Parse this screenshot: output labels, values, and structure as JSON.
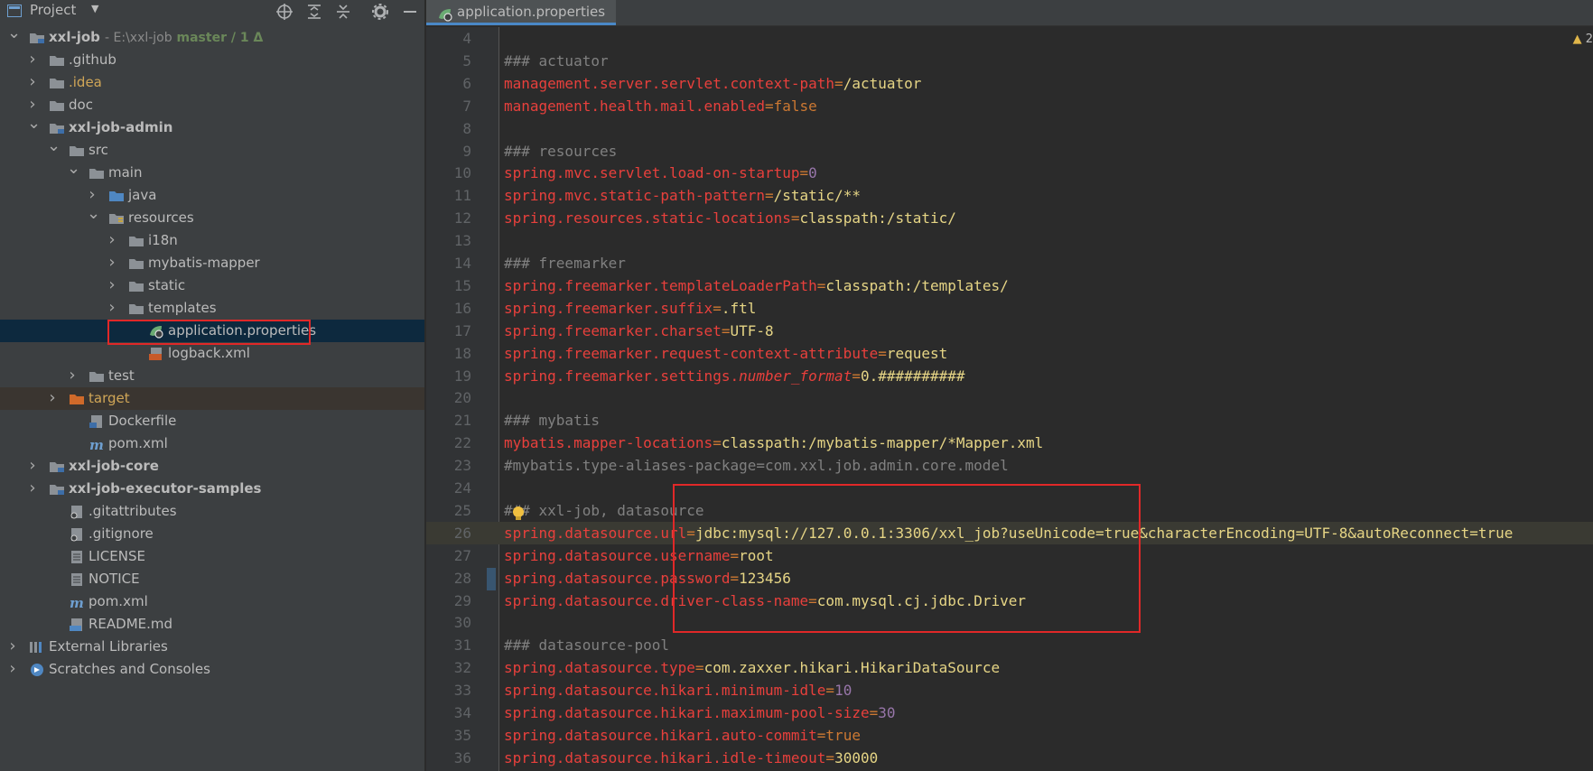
{
  "project_panel": {
    "title": "Project",
    "tree": [
      {
        "label": "xxl-job",
        "bold": true,
        "extra": " - E:\\xxl-job",
        "branch": " master / 1 Δ",
        "depth": 0,
        "arrow": "v",
        "icon": "module-folder-icon"
      },
      {
        "label": ".github",
        "depth": 1,
        "arrow": ">",
        "icon": "folder-icon"
      },
      {
        "label": ".idea",
        "depth": 1,
        "arrow": ">",
        "icon": "folder-icon",
        "style": "excluded-text"
      },
      {
        "label": "doc",
        "depth": 1,
        "arrow": ">",
        "icon": "folder-icon"
      },
      {
        "label": "xxl-job-admin",
        "bold": true,
        "depth": 1,
        "arrow": "v",
        "icon": "module-folder-icon"
      },
      {
        "label": "src",
        "depth": 2,
        "arrow": "v",
        "icon": "folder-icon"
      },
      {
        "label": "main",
        "depth": 3,
        "arrow": "v",
        "icon": "folder-icon"
      },
      {
        "label": "java",
        "depth": 4,
        "arrow": ">",
        "icon": "source-folder-icon"
      },
      {
        "label": "resources",
        "depth": 4,
        "arrow": "v",
        "icon": "resources-folder-icon"
      },
      {
        "label": "i18n",
        "depth": 5,
        "arrow": ">",
        "icon": "folder-icon"
      },
      {
        "label": "mybatis-mapper",
        "depth": 5,
        "arrow": ">",
        "icon": "folder-icon"
      },
      {
        "label": "static",
        "depth": 5,
        "arrow": ">",
        "icon": "folder-icon"
      },
      {
        "label": "templates",
        "depth": 5,
        "arrow": ">",
        "icon": "folder-icon"
      },
      {
        "label": "application.properties",
        "depth": 6,
        "arrow": "",
        "icon": "spring-properties-icon",
        "selected": true
      },
      {
        "label": "logback.xml",
        "depth": 6,
        "arrow": "",
        "icon": "xml-file-icon"
      },
      {
        "label": "test",
        "depth": 3,
        "arrow": ">",
        "icon": "folder-icon"
      },
      {
        "label": "target",
        "depth": 2,
        "arrow": ">",
        "icon": "excluded-folder-icon",
        "style": "excluded-text",
        "excluded": true
      },
      {
        "label": "Dockerfile",
        "depth": 3,
        "arrow": "",
        "icon": "docker-file-icon"
      },
      {
        "label": "pom.xml",
        "depth": 3,
        "arrow": "",
        "icon": "maven-icon"
      },
      {
        "label": "xxl-job-core",
        "bold": true,
        "depth": 1,
        "arrow": ">",
        "icon": "module-folder-icon"
      },
      {
        "label": "xxl-job-executor-samples",
        "bold": true,
        "depth": 1,
        "arrow": ">",
        "icon": "module-folder-icon"
      },
      {
        "label": ".gitattributes",
        "depth": 2,
        "arrow": "",
        "icon": "git-file-icon"
      },
      {
        "label": ".gitignore",
        "depth": 2,
        "arrow": "",
        "icon": "git-file-icon"
      },
      {
        "label": "LICENSE",
        "depth": 2,
        "arrow": "",
        "icon": "text-file-icon"
      },
      {
        "label": "NOTICE",
        "depth": 2,
        "arrow": "",
        "icon": "text-file-icon"
      },
      {
        "label": "pom.xml",
        "depth": 2,
        "arrow": "",
        "icon": "maven-icon"
      },
      {
        "label": "README.md",
        "depth": 2,
        "arrow": "",
        "icon": "markdown-file-icon"
      },
      {
        "label": "External Libraries",
        "depth": 0,
        "arrow": ">",
        "icon": "libraries-icon"
      },
      {
        "label": "Scratches and Consoles",
        "depth": 0,
        "arrow": ">",
        "icon": "scratches-icon"
      }
    ]
  },
  "editor": {
    "tab_label": "application.properties",
    "warning_count": "2",
    "current_line": 26,
    "lines": [
      {
        "no": "4",
        "parts": []
      },
      {
        "no": "5",
        "parts": [
          {
            "t": "### actuator",
            "c": "c"
          }
        ]
      },
      {
        "no": "6",
        "parts": [
          {
            "t": "management.server.servlet.context-path",
            "c": "k"
          },
          {
            "t": "=",
            "c": "eq"
          },
          {
            "t": "/actuator",
            "c": "v"
          }
        ]
      },
      {
        "no": "7",
        "parts": [
          {
            "t": "management.health.mail.enabled",
            "c": "k"
          },
          {
            "t": "=",
            "c": "eq"
          },
          {
            "t": "false",
            "c": "eq"
          }
        ]
      },
      {
        "no": "8",
        "parts": []
      },
      {
        "no": "9",
        "parts": [
          {
            "t": "### resources",
            "c": "c"
          }
        ]
      },
      {
        "no": "10",
        "parts": [
          {
            "t": "spring.mvc.servlet.load-on-startup",
            "c": "k"
          },
          {
            "t": "=",
            "c": "eq"
          },
          {
            "t": "0",
            "c": "n"
          }
        ]
      },
      {
        "no": "11",
        "parts": [
          {
            "t": "spring.mvc.static-path-pattern",
            "c": "k"
          },
          {
            "t": "=",
            "c": "eq"
          },
          {
            "t": "/static/**",
            "c": "v"
          }
        ]
      },
      {
        "no": "12",
        "parts": [
          {
            "t": "spring.resources.static-locations",
            "c": "k"
          },
          {
            "t": "=",
            "c": "eq"
          },
          {
            "t": "classpath:/static/",
            "c": "v"
          }
        ]
      },
      {
        "no": "13",
        "parts": []
      },
      {
        "no": "14",
        "parts": [
          {
            "t": "### freemarker",
            "c": "c"
          }
        ]
      },
      {
        "no": "15",
        "parts": [
          {
            "t": "spring.freemarker.templateLoaderPath",
            "c": "k"
          },
          {
            "t": "=",
            "c": "eq"
          },
          {
            "t": "classpath:/templates/",
            "c": "v"
          }
        ]
      },
      {
        "no": "16",
        "parts": [
          {
            "t": "spring.freemarker.suffix",
            "c": "k"
          },
          {
            "t": "=",
            "c": "eq"
          },
          {
            "t": ".ftl",
            "c": "v"
          }
        ]
      },
      {
        "no": "17",
        "parts": [
          {
            "t": "spring.freemarker.charset",
            "c": "k"
          },
          {
            "t": "=",
            "c": "eq"
          },
          {
            "t": "UTF-8",
            "c": "v"
          }
        ]
      },
      {
        "no": "18",
        "parts": [
          {
            "t": "spring.freemarker.request-context-attribute",
            "c": "k"
          },
          {
            "t": "=",
            "c": "eq"
          },
          {
            "t": "request",
            "c": "v"
          }
        ]
      },
      {
        "no": "19",
        "parts": [
          {
            "t": "spring.freemarker.settings.",
            "c": "k"
          },
          {
            "t": "number_format",
            "c": "k it"
          },
          {
            "t": "=",
            "c": "eq"
          },
          {
            "t": "0.##########",
            "c": "v"
          }
        ]
      },
      {
        "no": "20",
        "parts": []
      },
      {
        "no": "21",
        "parts": [
          {
            "t": "### mybatis",
            "c": "c"
          }
        ]
      },
      {
        "no": "22",
        "parts": [
          {
            "t": "mybatis.mapper-locations",
            "c": "k"
          },
          {
            "t": "=",
            "c": "eq"
          },
          {
            "t": "classpath:/mybatis-mapper/*Mapper.xml",
            "c": "v"
          }
        ]
      },
      {
        "no": "23",
        "parts": [
          {
            "t": "#mybatis.type-aliases-package=com.xxl.job.admin.core.model",
            "c": "c"
          }
        ]
      },
      {
        "no": "24",
        "parts": []
      },
      {
        "no": "25",
        "parts": [
          {
            "t": "### xxl-job, datasource",
            "c": "c"
          }
        ]
      },
      {
        "no": "26",
        "parts": [
          {
            "t": "spring.datasource.url",
            "c": "k"
          },
          {
            "t": "=",
            "c": "eq"
          },
          {
            "t": "jdbc:mysql://127.0.0.1:3306/xxl_job?useUnicode=true&characterEncoding=UTF-8&autoReconnect=true",
            "c": "v"
          }
        ]
      },
      {
        "no": "27",
        "parts": [
          {
            "t": "spring.datasource.username",
            "c": "k"
          },
          {
            "t": "=",
            "c": "eq"
          },
          {
            "t": "root",
            "c": "v"
          }
        ]
      },
      {
        "no": "28",
        "parts": [
          {
            "t": "spring.datasource.password",
            "c": "k"
          },
          {
            "t": "=",
            "c": "eq"
          },
          {
            "t": "123456",
            "c": "v"
          }
        ]
      },
      {
        "no": "29",
        "parts": [
          {
            "t": "spring.datasource.driver-class-name",
            "c": "k"
          },
          {
            "t": "=",
            "c": "eq"
          },
          {
            "t": "com.mysql.cj.jdbc.Driver",
            "c": "v"
          }
        ]
      },
      {
        "no": "30",
        "parts": []
      },
      {
        "no": "31",
        "parts": [
          {
            "t": "### datasource-pool",
            "c": "c"
          }
        ]
      },
      {
        "no": "32",
        "parts": [
          {
            "t": "spring.datasource.type",
            "c": "k"
          },
          {
            "t": "=",
            "c": "eq"
          },
          {
            "t": "com.zaxxer.hikari.HikariDataSource",
            "c": "v"
          }
        ]
      },
      {
        "no": "33",
        "parts": [
          {
            "t": "spring.datasource.hikari.minimum-idle",
            "c": "k"
          },
          {
            "t": "=",
            "c": "eq"
          },
          {
            "t": "10",
            "c": "n"
          }
        ]
      },
      {
        "no": "34",
        "parts": [
          {
            "t": "spring.datasource.hikari.maximum-pool-size",
            "c": "k"
          },
          {
            "t": "=",
            "c": "eq"
          },
          {
            "t": "30",
            "c": "n"
          }
        ]
      },
      {
        "no": "35",
        "parts": [
          {
            "t": "spring.datasource.hikari.auto-commit",
            "c": "k"
          },
          {
            "t": "=",
            "c": "eq"
          },
          {
            "t": "true",
            "c": "eq"
          }
        ]
      },
      {
        "no": "36",
        "parts": [
          {
            "t": "spring.datasource.hikari.idle-timeout",
            "c": "k"
          },
          {
            "t": "=",
            "c": "eq"
          },
          {
            "t": "30000",
            "c": "v"
          }
        ]
      }
    ]
  },
  "colors": {
    "panel_bg": "#3c3f41",
    "editor_bg": "#2b2b2b",
    "selection": "#0d293e",
    "annotation_red": "#e02828",
    "key": "#e8403c",
    "value": "#e6d585",
    "number": "#9876aa",
    "comment": "#808080"
  }
}
